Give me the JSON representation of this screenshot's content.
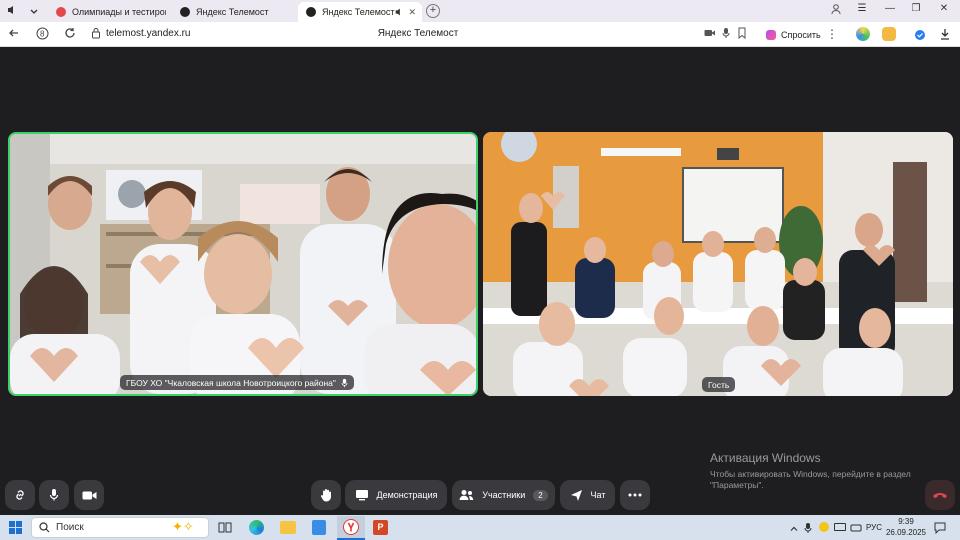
{
  "browser": {
    "tabs": [
      {
        "label": "Олимпиады и тестирован",
        "active": false,
        "favicon_color": "#e24a4a"
      },
      {
        "label": "Яндекс Телемост",
        "active": false,
        "favicon_color": "#222222"
      },
      {
        "label": "Яндекс Телемост",
        "active": true,
        "favicon_color": "#222222"
      }
    ],
    "url": "telemost.yandex.ru",
    "page_title": "Яндекс Телемост",
    "ask_label": "Спросить"
  },
  "call": {
    "participants": [
      {
        "name": "ГБОУ ХО \"Чкаловская школа Новотроицкого района\"",
        "speaking": true,
        "highlight_color": "#3fd06a"
      },
      {
        "name": "Гость",
        "speaking": false
      }
    ],
    "toolbar": {
      "demo_label": "Демонстрация",
      "participants_label": "Участники",
      "participants_count": "2",
      "chat_label": "Чат"
    },
    "end_call_color": "#cc2c2c"
  },
  "watermark": {
    "title": "Активация Windows",
    "line1": "Чтобы активировать Windows, перейдите в раздел",
    "line2": "\"Параметры\"."
  },
  "taskbar": {
    "search_placeholder": "Поиск",
    "lang": "РУС",
    "time": "9:39",
    "date": "26.09.2025"
  }
}
